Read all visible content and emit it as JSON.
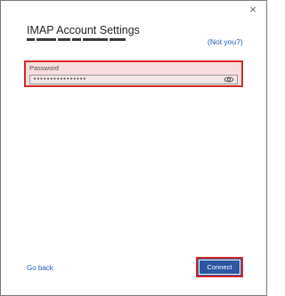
{
  "dialog": {
    "close_glyph": "×",
    "title": "IMAP Account Settings",
    "not_you_link": "(Not you?)"
  },
  "password": {
    "label": "Password",
    "value": "••••••••••••••••",
    "eye_icon": "eye-icon"
  },
  "footer": {
    "go_back_label": "Go back",
    "connect_label": "Connect"
  },
  "colors": {
    "accent_blue": "#2b57a3",
    "link_blue": "#1f5fb4",
    "highlight_red": "#d22b2b",
    "field_bg": "#f7dede"
  }
}
